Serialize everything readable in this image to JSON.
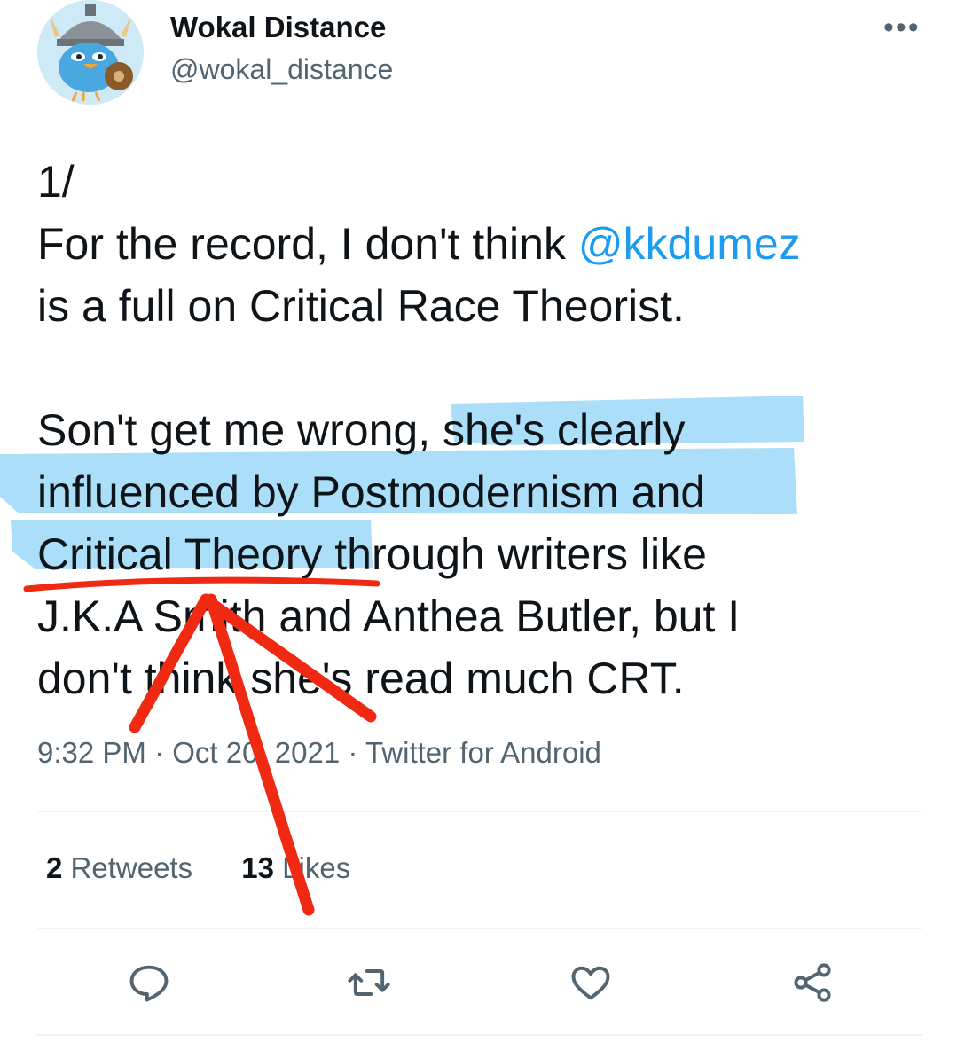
{
  "author": {
    "display_name": "Wokal Distance",
    "handle": "@wokal_distance"
  },
  "menu": {
    "more_label": "•••"
  },
  "tweet": {
    "line1": "1/",
    "line2_pre": "For the record, I don't think ",
    "mention": "@kkdumez",
    "line3": "is a full on Critical Race Theorist.",
    "line5": "Son't get me wrong, she's clearly",
    "line6": "influenced by Postmodernism and",
    "line7": "Critical Theory through writers like",
    "line8": "J.K.A Smith and Anthea Butler, but I",
    "line9": "don't think she's read much CRT."
  },
  "meta": {
    "time": "9:32 PM",
    "date": "Oct 20, 2021",
    "source": "Twitter for Android",
    "separator": " · "
  },
  "stats": {
    "retweets_count": "2",
    "retweets_label": "Retweets",
    "likes_count": "13",
    "likes_label": "Likes"
  },
  "colors": {
    "accent": "#1d9bf0",
    "highlight": "#8fd3f5",
    "annotation_red": "#f02a12",
    "secondary_text": "#536471"
  },
  "icons": [
    "reply-icon",
    "retweet-icon",
    "like-icon",
    "share-icon"
  ]
}
